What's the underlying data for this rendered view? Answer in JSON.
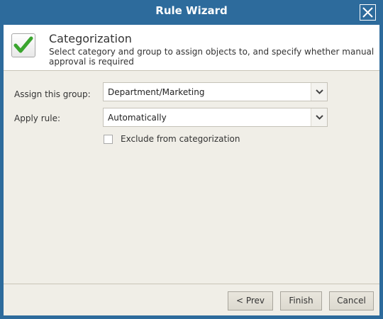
{
  "window": {
    "title": "Rule Wizard"
  },
  "header": {
    "title": "Categorization",
    "description": "Select category and group to assign objects to, and specify whether manual approval is required"
  },
  "form": {
    "assign_group_label": "Assign this group:",
    "assign_group_value": "Department/Marketing",
    "apply_rule_label": "Apply rule:",
    "apply_rule_value": "Automatically",
    "exclude_label": "Exclude from categorization",
    "exclude_checked": false
  },
  "footer": {
    "prev_label": "< Prev",
    "finish_label": "Finish",
    "cancel_label": "Cancel"
  },
  "colors": {
    "titlebar": "#2d6b9c",
    "body_background": "#f0eee7",
    "check_green": "#3aa52e"
  }
}
